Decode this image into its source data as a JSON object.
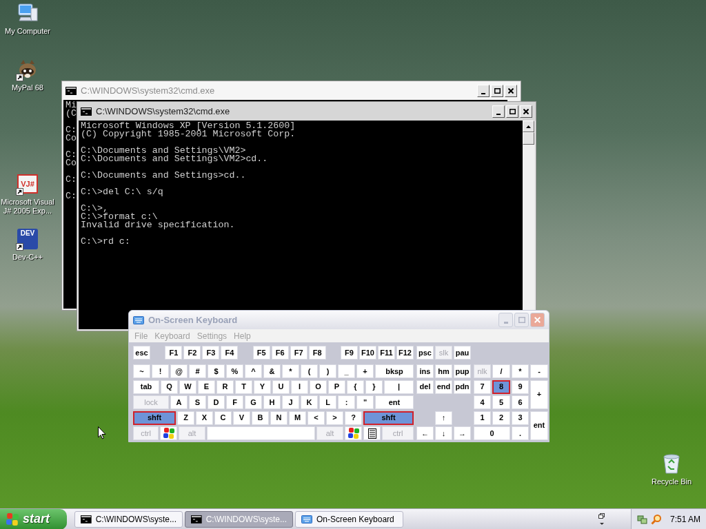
{
  "desktop_icons": [
    {
      "label": "My Computer",
      "kind": "computer",
      "shortcut": false
    },
    {
      "label": "MyPal 68",
      "kind": "animal",
      "shortcut": true
    },
    {
      "label": "Microsoft Visual J# 2005 Exp...",
      "kind": "vjlogo",
      "logo_text": "VJ#",
      "shortcut": true
    },
    {
      "label": "Dev-C++",
      "kind": "devlogo",
      "logo_text": "DEV",
      "shortcut": true
    },
    {
      "label": "Recycle Bin",
      "kind": "bin",
      "shortcut": false
    }
  ],
  "console_windows": [
    {
      "title": "C:\\WINDOWS\\system32\\cmd.exe",
      "active": false,
      "blocks": [
        [
          "Mi",
          "(C"
        ],
        [
          "C:",
          "Co"
        ],
        [
          "C:",
          "Co"
        ],
        [
          "C:"
        ],
        [
          "C:"
        ]
      ]
    },
    {
      "title": "C:\\WINDOWS\\system32\\cmd.exe",
      "active": true,
      "blocks": [
        [
          "Microsoft Windows XP [Version 5.1.2600]",
          "(C) Copyright 1985-2001 Microsoft Corp."
        ],
        [
          "C:\\Documents and Settings\\VM2>",
          "C:\\Documents and Settings\\VM2>cd.."
        ],
        [
          "C:\\Documents and Settings>cd.."
        ],
        [
          "C:\\>del C:\\ s/q"
        ],
        [
          "C:\\>,",
          "C:\\>format c:\\",
          "Invalid drive specification."
        ],
        [
          "C:\\>rd c:"
        ]
      ]
    }
  ],
  "keyboard_window": {
    "title": "On-Screen Keyboard",
    "active": false,
    "menu": [
      "File",
      "Keyboard",
      "Settings",
      "Help"
    ],
    "function_keys": [
      [
        {
          "label": "esc",
          "kind": "key",
          "pressed": false,
          "disabled": false
        }
      ],
      [
        {
          "label": "F1",
          "kind": "key",
          "pressed": false,
          "disabled": false
        },
        {
          "label": "F2",
          "kind": "key",
          "pressed": false,
          "disabled": false
        },
        {
          "label": "F3",
          "kind": "key",
          "pressed": false,
          "disabled": false
        },
        {
          "label": "F4",
          "kind": "key",
          "pressed": false,
          "disabled": false
        }
      ],
      [
        {
          "label": "F5",
          "kind": "key",
          "pressed": false,
          "disabled": false
        },
        {
          "label": "F6",
          "kind": "key",
          "pressed": false,
          "disabled": false
        },
        {
          "label": "F7",
          "kind": "key",
          "pressed": false,
          "disabled": false
        },
        {
          "label": "F8",
          "kind": "key",
          "pressed": false,
          "disabled": false
        }
      ],
      [
        {
          "label": "F9",
          "kind": "key",
          "pressed": false,
          "disabled": false
        },
        {
          "label": "F10",
          "kind": "key",
          "pressed": false,
          "disabled": false
        },
        {
          "label": "F11",
          "kind": "key",
          "pressed": false,
          "disabled": false
        },
        {
          "label": "F12",
          "kind": "key",
          "pressed": false,
          "disabled": false
        }
      ]
    ],
    "main_rows": [
      [
        {
          "label": "~",
          "kind": "key",
          "pressed": false,
          "disabled": false
        },
        {
          "label": "!",
          "kind": "key",
          "pressed": false,
          "disabled": false
        },
        {
          "label": "@",
          "kind": "key",
          "pressed": false,
          "disabled": false
        },
        {
          "label": "#",
          "kind": "key",
          "pressed": false,
          "disabled": false
        },
        {
          "label": "$",
          "kind": "key",
          "pressed": false,
          "disabled": false
        },
        {
          "label": "%",
          "kind": "key",
          "pressed": false,
          "disabled": false
        },
        {
          "label": "^",
          "kind": "key",
          "pressed": false,
          "disabled": false
        },
        {
          "label": "&",
          "kind": "key",
          "pressed": false,
          "disabled": false
        },
        {
          "label": "*",
          "kind": "key",
          "pressed": false,
          "disabled": false
        },
        {
          "label": "(",
          "kind": "key",
          "pressed": false,
          "disabled": false
        },
        {
          "label": ")",
          "kind": "key",
          "pressed": false,
          "disabled": false
        },
        {
          "label": "_",
          "kind": "key",
          "pressed": false,
          "disabled": false
        },
        {
          "label": "+",
          "kind": "key",
          "pressed": false,
          "disabled": false
        },
        {
          "label": "bksp",
          "kind": "backspace",
          "pressed": false,
          "disabled": false
        }
      ],
      [
        {
          "label": "tab",
          "kind": "tab",
          "pressed": false,
          "disabled": false
        },
        {
          "label": "Q",
          "kind": "key",
          "pressed": false,
          "disabled": false
        },
        {
          "label": "W",
          "kind": "key",
          "pressed": false,
          "disabled": false
        },
        {
          "label": "E",
          "kind": "key",
          "pressed": false,
          "disabled": false
        },
        {
          "label": "R",
          "kind": "key",
          "pressed": false,
          "disabled": false
        },
        {
          "label": "T",
          "kind": "key",
          "pressed": false,
          "disabled": false
        },
        {
          "label": "Y",
          "kind": "key",
          "pressed": false,
          "disabled": false
        },
        {
          "label": "U",
          "kind": "key",
          "pressed": false,
          "disabled": false
        },
        {
          "label": "I",
          "kind": "key",
          "pressed": false,
          "disabled": false
        },
        {
          "label": "O",
          "kind": "key",
          "pressed": false,
          "disabled": false
        },
        {
          "label": "P",
          "kind": "key",
          "pressed": false,
          "disabled": false
        },
        {
          "label": "{",
          "kind": "key",
          "pressed": false,
          "disabled": false
        },
        {
          "label": "}",
          "kind": "key",
          "pressed": false,
          "disabled": false
        },
        {
          "label": "|",
          "kind": "backslash",
          "pressed": false,
          "disabled": false
        }
      ],
      [
        {
          "label": "lock",
          "kind": "caps",
          "pressed": false,
          "disabled": true
        },
        {
          "label": "A",
          "kind": "key",
          "pressed": false,
          "disabled": false
        },
        {
          "label": "S",
          "kind": "key",
          "pressed": false,
          "disabled": false
        },
        {
          "label": "D",
          "kind": "key",
          "pressed": false,
          "disabled": false
        },
        {
          "label": "F",
          "kind": "key",
          "pressed": false,
          "disabled": false
        },
        {
          "label": "G",
          "kind": "key",
          "pressed": false,
          "disabled": false
        },
        {
          "label": "H",
          "kind": "key",
          "pressed": false,
          "disabled": false
        },
        {
          "label": "J",
          "kind": "key",
          "pressed": false,
          "disabled": false
        },
        {
          "label": "K",
          "kind": "key",
          "pressed": false,
          "disabled": false
        },
        {
          "label": "L",
          "kind": "key",
          "pressed": false,
          "disabled": false
        },
        {
          "label": ":",
          "kind": "key",
          "pressed": false,
          "disabled": false
        },
        {
          "label": "\"",
          "kind": "key",
          "pressed": false,
          "disabled": false
        },
        {
          "label": "ent",
          "kind": "enter",
          "pressed": false,
          "disabled": false
        }
      ],
      [
        {
          "label": "shft",
          "kind": "shift",
          "pressed": true,
          "disabled": false
        },
        {
          "label": "Z",
          "kind": "key",
          "pressed": false,
          "disabled": false
        },
        {
          "label": "X",
          "kind": "key",
          "pressed": false,
          "disabled": false
        },
        {
          "label": "C",
          "kind": "key",
          "pressed": false,
          "disabled": false
        },
        {
          "label": "V",
          "kind": "key",
          "pressed": false,
          "disabled": false
        },
        {
          "label": "B",
          "kind": "key",
          "pressed": false,
          "disabled": false
        },
        {
          "label": "N",
          "kind": "key",
          "pressed": false,
          "disabled": false
        },
        {
          "label": "M",
          "kind": "key",
          "pressed": false,
          "disabled": false
        },
        {
          "label": "<",
          "kind": "key",
          "pressed": false,
          "disabled": false
        },
        {
          "label": ">",
          "kind": "key",
          "pressed": false,
          "disabled": false
        },
        {
          "label": "?",
          "kind": "key",
          "pressed": false,
          "disabled": false
        },
        {
          "label": "shft",
          "kind": "shift",
          "pressed": true,
          "disabled": false
        }
      ],
      [
        {
          "label": "ctrl",
          "kind": "ctrl",
          "pressed": false,
          "disabled": true
        },
        {
          "kind": "win",
          "pressed": false,
          "disabled": false
        },
        {
          "label": "alt",
          "kind": "alt",
          "pressed": false,
          "disabled": true
        },
        {
          "kind": "space",
          "pressed": false,
          "disabled": false
        },
        {
          "label": "alt",
          "kind": "alt",
          "pressed": false,
          "disabled": true
        },
        {
          "kind": "win",
          "pressed": false,
          "disabled": false
        },
        {
          "kind": "menu",
          "pressed": false,
          "disabled": false
        },
        {
          "label": "ctrl",
          "kind": "ctrl",
          "pressed": false,
          "disabled": true
        }
      ]
    ],
    "edit_keys": [
      [
        {
          "label": "psc",
          "kind": "key",
          "pressed": false,
          "disabled": false
        },
        {
          "label": "slk",
          "kind": "key",
          "pressed": false,
          "disabled": true
        },
        {
          "label": "pau",
          "kind": "key",
          "pressed": false,
          "disabled": false
        }
      ],
      [
        {
          "label": "ins",
          "kind": "key",
          "pressed": false,
          "disabled": false
        },
        {
          "label": "hm",
          "kind": "key",
          "pressed": false,
          "disabled": false
        },
        {
          "label": "pup",
          "kind": "key",
          "pressed": false,
          "disabled": false
        }
      ],
      [
        {
          "label": "del",
          "kind": "key",
          "pressed": false,
          "disabled": false
        },
        {
          "label": "end",
          "kind": "key",
          "pressed": false,
          "disabled": false
        },
        {
          "label": "pdn",
          "kind": "key",
          "pressed": false,
          "disabled": false
        }
      ]
    ],
    "arrow_keys": [
      [
        {
          "label": "↑",
          "kind": "key",
          "pressed": false,
          "disabled": false
        }
      ],
      [
        {
          "label": "←",
          "kind": "key",
          "pressed": false,
          "disabled": false
        },
        {
          "label": "↓",
          "kind": "key",
          "pressed": false,
          "disabled": false
        },
        {
          "label": "→",
          "kind": "key",
          "pressed": false,
          "disabled": false
        }
      ]
    ],
    "numpad": [
      {
        "label": "nlk",
        "kind": "key",
        "pressed": false,
        "disabled": true
      },
      {
        "label": "/",
        "kind": "key",
        "pressed": false,
        "disabled": false
      },
      {
        "label": "*",
        "kind": "key",
        "pressed": false,
        "disabled": false
      },
      {
        "label": "-",
        "kind": "key",
        "pressed": false,
        "disabled": false
      },
      {
        "label": "7",
        "kind": "key",
        "pressed": false,
        "disabled": false
      },
      {
        "label": "8",
        "kind": "key",
        "pressed": true,
        "disabled": false
      },
      {
        "label": "9",
        "kind": "key",
        "pressed": false,
        "disabled": false
      },
      {
        "label": "+",
        "kind": "tall",
        "pressed": false,
        "disabled": false
      },
      {
        "label": "4",
        "kind": "key",
        "pressed": false,
        "disabled": false
      },
      {
        "label": "5",
        "kind": "key",
        "pressed": false,
        "disabled": false
      },
      {
        "label": "6",
        "kind": "key",
        "pressed": false,
        "disabled": false
      },
      {
        "label": "1",
        "kind": "key",
        "pressed": false,
        "disabled": false
      },
      {
        "label": "2",
        "kind": "key",
        "pressed": false,
        "disabled": false
      },
      {
        "label": "3",
        "kind": "key",
        "pressed": false,
        "disabled": false
      },
      {
        "label": "ent",
        "kind": "tall",
        "pressed": false,
        "disabled": false
      },
      {
        "label": "0",
        "kind": "wide",
        "pressed": false,
        "disabled": false
      },
      {
        "label": ".",
        "kind": "key",
        "pressed": false,
        "disabled": false
      }
    ]
  },
  "taskbar": {
    "start": "start",
    "tasks": [
      {
        "label": "C:\\WINDOWS\\syste...",
        "kind": "console",
        "selected": false
      },
      {
        "label": "C:\\WINDOWS\\syste...",
        "kind": "console",
        "selected": true
      },
      {
        "label": "On-Screen Keyboard",
        "kind": "keyboard",
        "selected": false
      }
    ],
    "clock": "7:51 AM"
  }
}
